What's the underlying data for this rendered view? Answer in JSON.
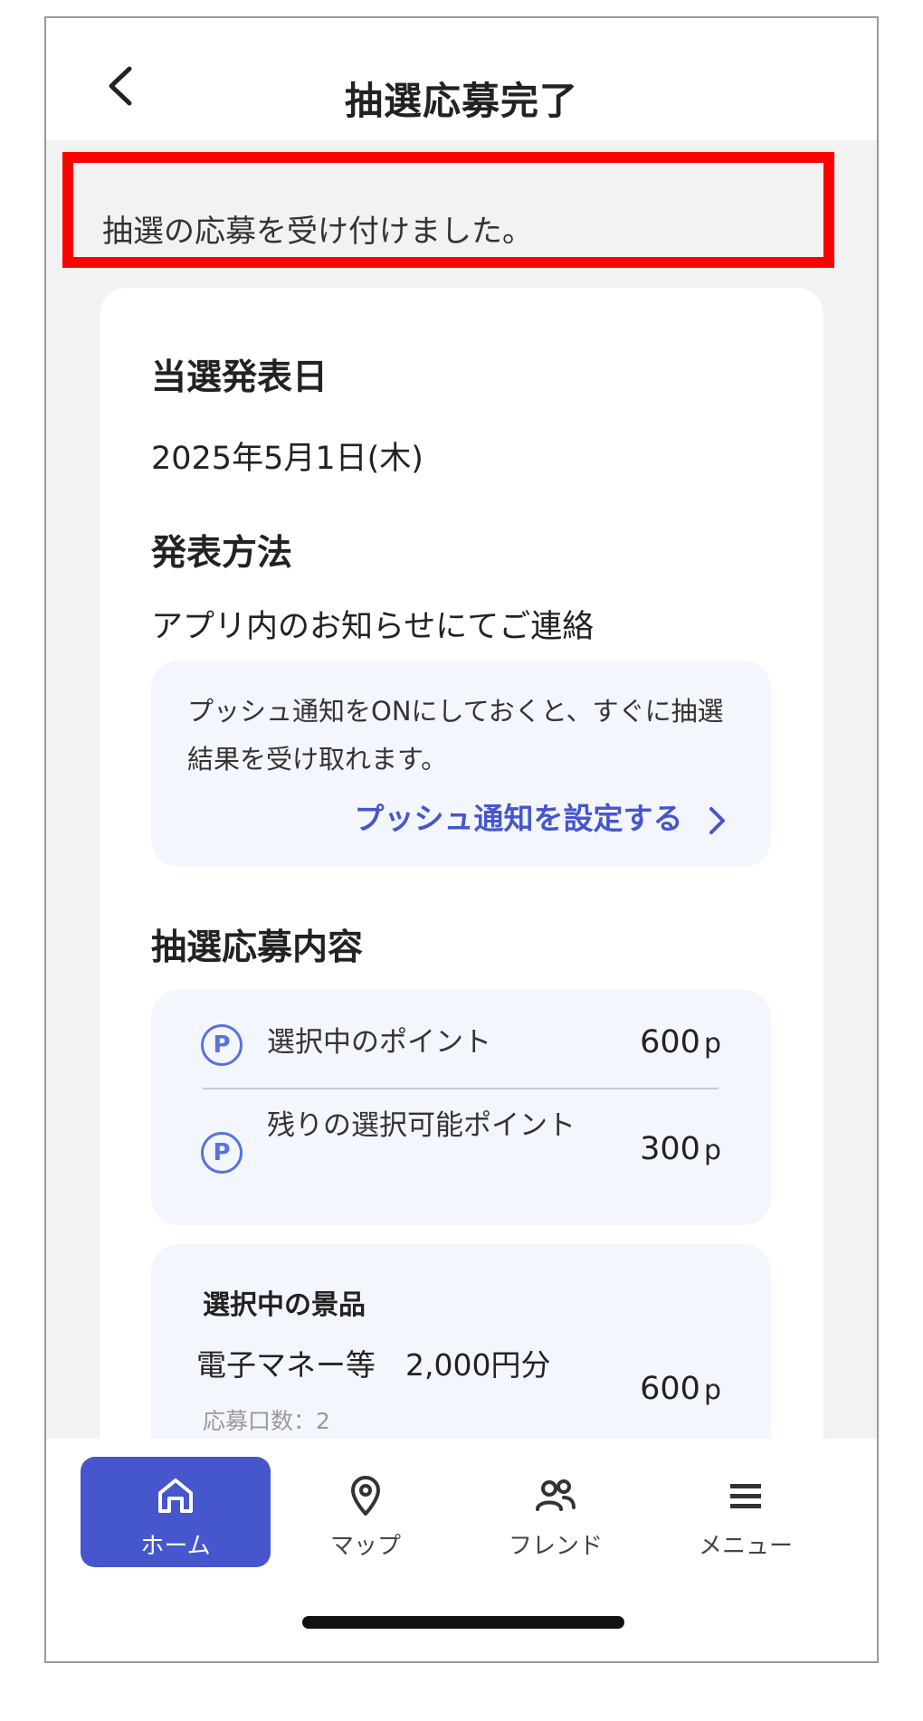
{
  "header": {
    "title": "抽選応募完了"
  },
  "notice": {
    "text": "抽選の応募を受け付けました。"
  },
  "announcement_date": {
    "title": "当選発表日",
    "value": "2025年5月1日(木)"
  },
  "announcement_method": {
    "title": "発表方法",
    "value": "アプリ内のお知らせにてご連絡",
    "push_note": "プッシュ通知をONにしておくと、すぐに抽選結果を受け取れます。",
    "push_link": "プッシュ通知を設定する"
  },
  "entry": {
    "title": "抽選応募内容",
    "points": [
      {
        "icon": "P",
        "label": "選択中のポイント",
        "value": "600",
        "unit": "p"
      },
      {
        "icon": "P",
        "label": "残りの選択可能ポイント",
        "value": "300",
        "unit": "p"
      }
    ],
    "prize": {
      "heading": "選択中の景品",
      "name": "電子マネー等　2,000円分",
      "count": "応募口数：2",
      "value": "600",
      "unit": "p"
    }
  },
  "tabs": [
    {
      "label": "ホーム",
      "icon": "home-icon",
      "active": true
    },
    {
      "label": "マップ",
      "icon": "map-pin-icon",
      "active": false
    },
    {
      "label": "フレンド",
      "icon": "friends-icon",
      "active": false
    },
    {
      "label": "メニュー",
      "icon": "menu-icon",
      "active": false
    }
  ],
  "colors": {
    "accent": "#4656cc",
    "highlight": "#ff0000",
    "panel": "#f4f6fd"
  }
}
